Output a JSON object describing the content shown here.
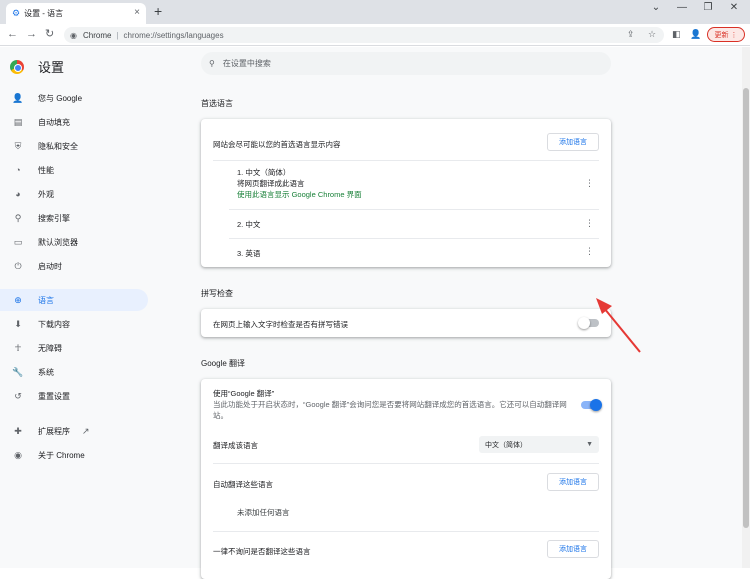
{
  "tab": {
    "icon": "gear-icon",
    "title": "设置 - 语言",
    "close": "×"
  },
  "new_tab": "+",
  "window": {
    "minimize": "⌄",
    "min2": "—",
    "max": "❐",
    "close": "✕"
  },
  "toolbar": {
    "back": "←",
    "forward": "→",
    "reload": "↻",
    "omnibox_site": "Chrome",
    "omnibox_url": "chrome://settings/languages",
    "update_label": "更新"
  },
  "sidebar": {
    "title": "设置",
    "items": [
      {
        "icon": "person-icon",
        "glyph": "👤",
        "label": "您与 Google"
      },
      {
        "icon": "autofill-icon",
        "glyph": "▤",
        "label": "自动填充"
      },
      {
        "icon": "shield-icon",
        "glyph": "⛨",
        "label": "隐私和安全"
      },
      {
        "icon": "speedometer-icon",
        "glyph": "◔",
        "label": "性能"
      },
      {
        "icon": "palette-icon",
        "glyph": "◕",
        "label": "外观"
      },
      {
        "icon": "search-icon",
        "glyph": "⚲",
        "label": "搜索引擎"
      },
      {
        "icon": "browser-icon",
        "glyph": "▭",
        "label": "默认浏览器"
      },
      {
        "icon": "power-icon",
        "glyph": "⏻",
        "label": "启动时"
      },
      {
        "icon": "globe-icon",
        "glyph": "⊕",
        "label": "语言"
      },
      {
        "icon": "download-icon",
        "glyph": "⬇",
        "label": "下载内容"
      },
      {
        "icon": "accessibility-icon",
        "glyph": "☥",
        "label": "无障碍"
      },
      {
        "icon": "wrench-icon",
        "glyph": "🔧",
        "label": "系统"
      },
      {
        "icon": "reset-icon",
        "glyph": "↺",
        "label": "重置设置"
      },
      {
        "icon": "puzzle-icon",
        "glyph": "✚",
        "label": "扩展程序"
      },
      {
        "icon": "chrome-icon",
        "glyph": "◉",
        "label": "关于 Chrome"
      }
    ],
    "extensions_external_icon": "↗"
  },
  "search": {
    "placeholder": "在设置中搜索"
  },
  "preferred_languages": {
    "section_title": "首选语言",
    "description": "网站会尽可能以您的首选语言显示内容",
    "add_button": "添加语言",
    "languages": [
      {
        "label": "1. 中文（简体）",
        "sub1": "将网页翻译成此语言",
        "sub2": "使用此语言显示 Google Chrome 界面"
      },
      {
        "label": "2. 中文"
      },
      {
        "label": "3. 英语"
      }
    ]
  },
  "spell_check": {
    "section_title": "拼写检查",
    "label": "在网页上输入文字时检查是否有拼写错误",
    "enabled": false
  },
  "google_translate": {
    "section_title": "Google 翻译",
    "use_title": "使用“Google 翻译”",
    "use_desc": "当此功能处于开启状态时，“Google 翻译”会询问您是否要将网站翻译成您的首选语言。它还可以自动翻译网站。",
    "enabled": true,
    "target_label": "翻译成该语言",
    "target_value": "中文（简体）",
    "auto_label": "自动翻译这些语言",
    "auto_button": "添加语言",
    "auto_empty": "未添加任何语言",
    "never_label": "一律不询问是否翻译这些语言",
    "never_button": "添加语言"
  },
  "colors": {
    "accent": "#1a73e8",
    "green_text": "#188038",
    "arrow": "#e53935"
  }
}
